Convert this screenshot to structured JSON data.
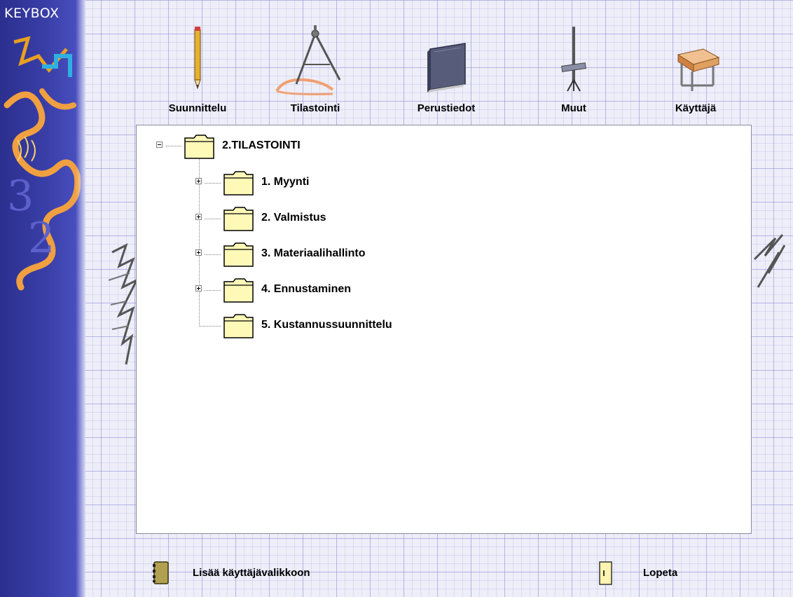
{
  "app": {
    "brand": "KEYBOX"
  },
  "toolbar": {
    "items": [
      {
        "label": "Suunnittelu",
        "icon": "pencil-icon"
      },
      {
        "label": "Tilastointi",
        "icon": "compass-icon"
      },
      {
        "label": "Perustiedot",
        "icon": "book-icon"
      },
      {
        "label": "Muut",
        "icon": "tool-icon"
      },
      {
        "label": "Käyttäjä",
        "icon": "desk-icon"
      }
    ]
  },
  "tree": {
    "root": {
      "label": "2.TILASTOINTI",
      "expanded": true
    },
    "children": [
      {
        "label": "1. Myynti",
        "expandable": true
      },
      {
        "label": "2. Valmistus",
        "expandable": true
      },
      {
        "label": "3. Materiaalihallinto",
        "expandable": true
      },
      {
        "label": "4. Ennustaminen",
        "expandable": true
      },
      {
        "label": "5. Kustannussuunnittelu",
        "expandable": false
      }
    ]
  },
  "footer": {
    "add_label": "Lisää käyttäjävalikkoon",
    "quit_label": "Lopeta"
  },
  "colors": {
    "left_strip": "#3a3fa8",
    "folder": "#fff9b8",
    "accent_orange": "#f0a030"
  }
}
